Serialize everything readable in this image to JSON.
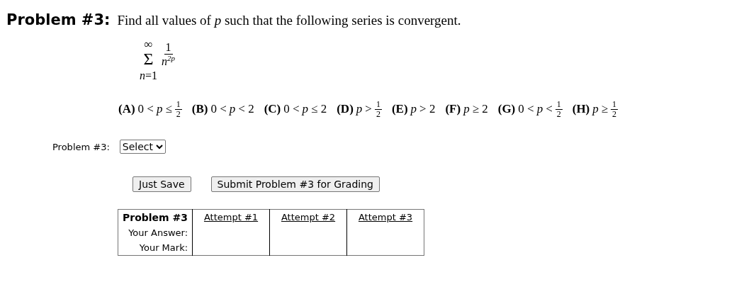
{
  "problem": {
    "label": "Problem #3:",
    "text": "Find all values of *p* such that the following series is convergent."
  },
  "series": {
    "upper": "∞",
    "symbol": "Σ",
    "lower": "*n*=1",
    "numerator": "1",
    "base": "n",
    "exponent": "2p"
  },
  "options": [
    {
      "label": "(A)",
      "condition": "0 < *p* ≤",
      "fraction": {
        "numerator": "1",
        "denominator": "2"
      }
    },
    {
      "label": "(B)",
      "condition": "0 < *p* < 2"
    },
    {
      "label": "(C)",
      "condition": "0 < *p* ≤ 2"
    },
    {
      "label": "(D)",
      "condition": "*p* >",
      "fraction": {
        "numerator": "1",
        "denominator": "2"
      }
    },
    {
      "label": "(E)",
      "condition": "*p* > 2"
    },
    {
      "label": "(F)",
      "condition": "*p* ≥ 2"
    },
    {
      "label": "(G)",
      "condition": "0 < *p* <",
      "fraction": {
        "numerator": "1",
        "denominator": "2"
      }
    },
    {
      "label": "(H)",
      "condition": "*p* ≥",
      "fraction": {
        "numerator": "1",
        "denominator": "2"
      }
    }
  ],
  "answer": {
    "label": "Problem #3:",
    "select": {
      "value": "Select"
    }
  },
  "buttons": [
    "Just Save",
    "Submit Problem #3 for Grading"
  ],
  "attempts_table": {
    "header": "Problem #3",
    "attempts": [
      "Attempt #1",
      "Attempt #2",
      "Attempt #3"
    ],
    "row_labels": [
      "Your Answer:",
      "Your Mark:"
    ]
  }
}
